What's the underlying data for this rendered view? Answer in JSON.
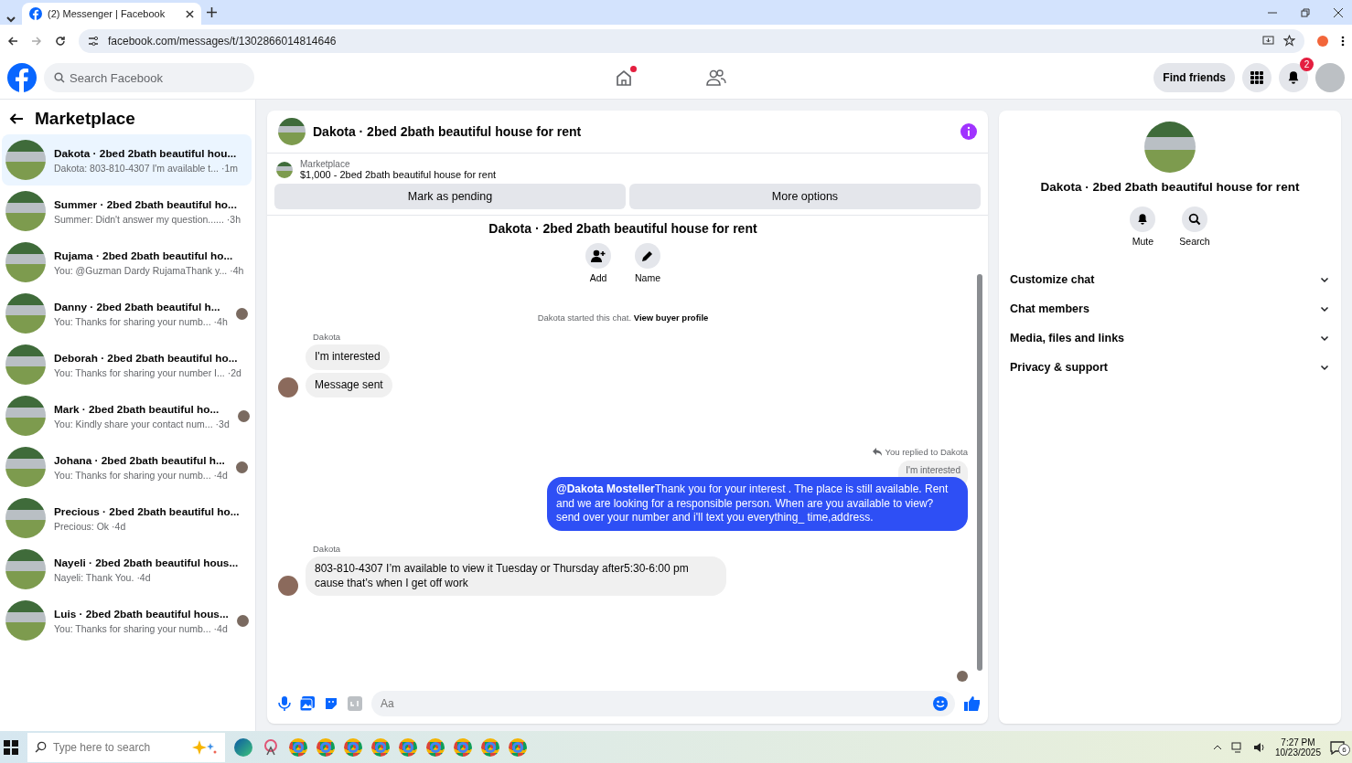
{
  "browser": {
    "tab_title": "(2) Messenger | Facebook",
    "url": "facebook.com/messages/t/1302866014814646"
  },
  "topbar": {
    "search_placeholder": "Search Facebook",
    "home_badge": true,
    "find_friends": "Find friends",
    "notifications_count": "2"
  },
  "sidebar": {
    "title": "Marketplace",
    "conversations": [
      {
        "title": "Dakota · 2bed 2bath beautiful hou...",
        "preview": "Dakota: 803-810-4307 I'm available t...",
        "time": "·1m",
        "selected": true,
        "seen": false
      },
      {
        "title": "Summer · 2bed 2bath beautiful ho...",
        "preview": "Summer: Didn't answer my question......",
        "time": "·3h",
        "selected": false,
        "seen": false
      },
      {
        "title": "Rujama · 2bed 2bath beautiful ho...",
        "preview": "You: @Guzman Dardy RujamaThank y...",
        "time": "·4h",
        "selected": false,
        "seen": false
      },
      {
        "title": "Danny · 2bed 2bath beautiful h...",
        "preview": "You: Thanks for sharing your numb...",
        "time": "·4h",
        "selected": false,
        "seen": true
      },
      {
        "title": "Deborah · 2bed 2bath beautiful ho...",
        "preview": "You: Thanks for sharing your number I...",
        "time": "·2d",
        "selected": false,
        "seen": false
      },
      {
        "title": "Mark · 2bed 2bath beautiful ho...",
        "preview": "You: Kindly share your contact num...",
        "time": "·3d",
        "selected": false,
        "seen": true
      },
      {
        "title": "Johana · 2bed 2bath beautiful h...",
        "preview": "You: Thanks for sharing your numb...",
        "time": "·4d",
        "selected": false,
        "seen": true
      },
      {
        "title": "Precious · 2bed 2bath beautiful ho...",
        "preview": "Precious: Ok",
        "time": "·4d",
        "selected": false,
        "seen": false
      },
      {
        "title": "Nayeli · 2bed 2bath beautiful hous...",
        "preview": "Nayeli: Thank You.",
        "time": "·4d",
        "selected": false,
        "seen": false
      },
      {
        "title": "Luis · 2bed 2bath beautiful hous...",
        "preview": "You: Thanks for sharing your numb...",
        "time": "·4d",
        "selected": false,
        "seen": true
      }
    ]
  },
  "chat": {
    "title": "Dakota · 2bed 2bath beautiful house for rent",
    "listing": {
      "source": "Marketplace",
      "summary": "$1,000 - 2bed 2bath beautiful house for rent",
      "buttons": [
        "Mark as pending",
        "More options"
      ]
    },
    "intro": {
      "title": "Dakota · 2bed 2bath beautiful house for rent",
      "actions": [
        "Add",
        "Name"
      ],
      "started": "Dakota started this chat.",
      "profile_link": "View buyer profile"
    },
    "messages": [
      {
        "kind": "received",
        "sender": "Dakota",
        "texts": [
          "I'm interested",
          "Message sent"
        ]
      },
      {
        "kind": "sent",
        "reply_label": "You replied to Dakota",
        "quoted": "I'm interested",
        "texts": [
          "**@Dakota Mosteller**Thank you for your interest . The place is still available. Rent and we are looking for a responsible person. When are you available to view? send over your number and i'll text you everything_ time,address."
        ]
      },
      {
        "kind": "received",
        "sender": "Dakota",
        "texts": [
          "803-810-4307 I’m available to view it Tuesday or Thursday after5:30-6:00 pm cause that’s when I get off work"
        ]
      }
    ],
    "composer_placeholder": "Aa"
  },
  "details": {
    "title": "Dakota · 2bed 2bath beautiful house for rent",
    "actions": [
      "Mute",
      "Search"
    ],
    "sections": [
      {
        "label": "Customize chat",
        "expanded": false
      },
      {
        "label": "Chat members",
        "expanded": false
      },
      {
        "label": "Media, files and links",
        "expanded": false
      },
      {
        "label": "Privacy & support",
        "expanded": false
      }
    ]
  },
  "taskbar": {
    "search_placeholder": "Type here to search",
    "time": "7:27 PM",
    "date": "10/23/2025",
    "notifications_count": "6"
  }
}
